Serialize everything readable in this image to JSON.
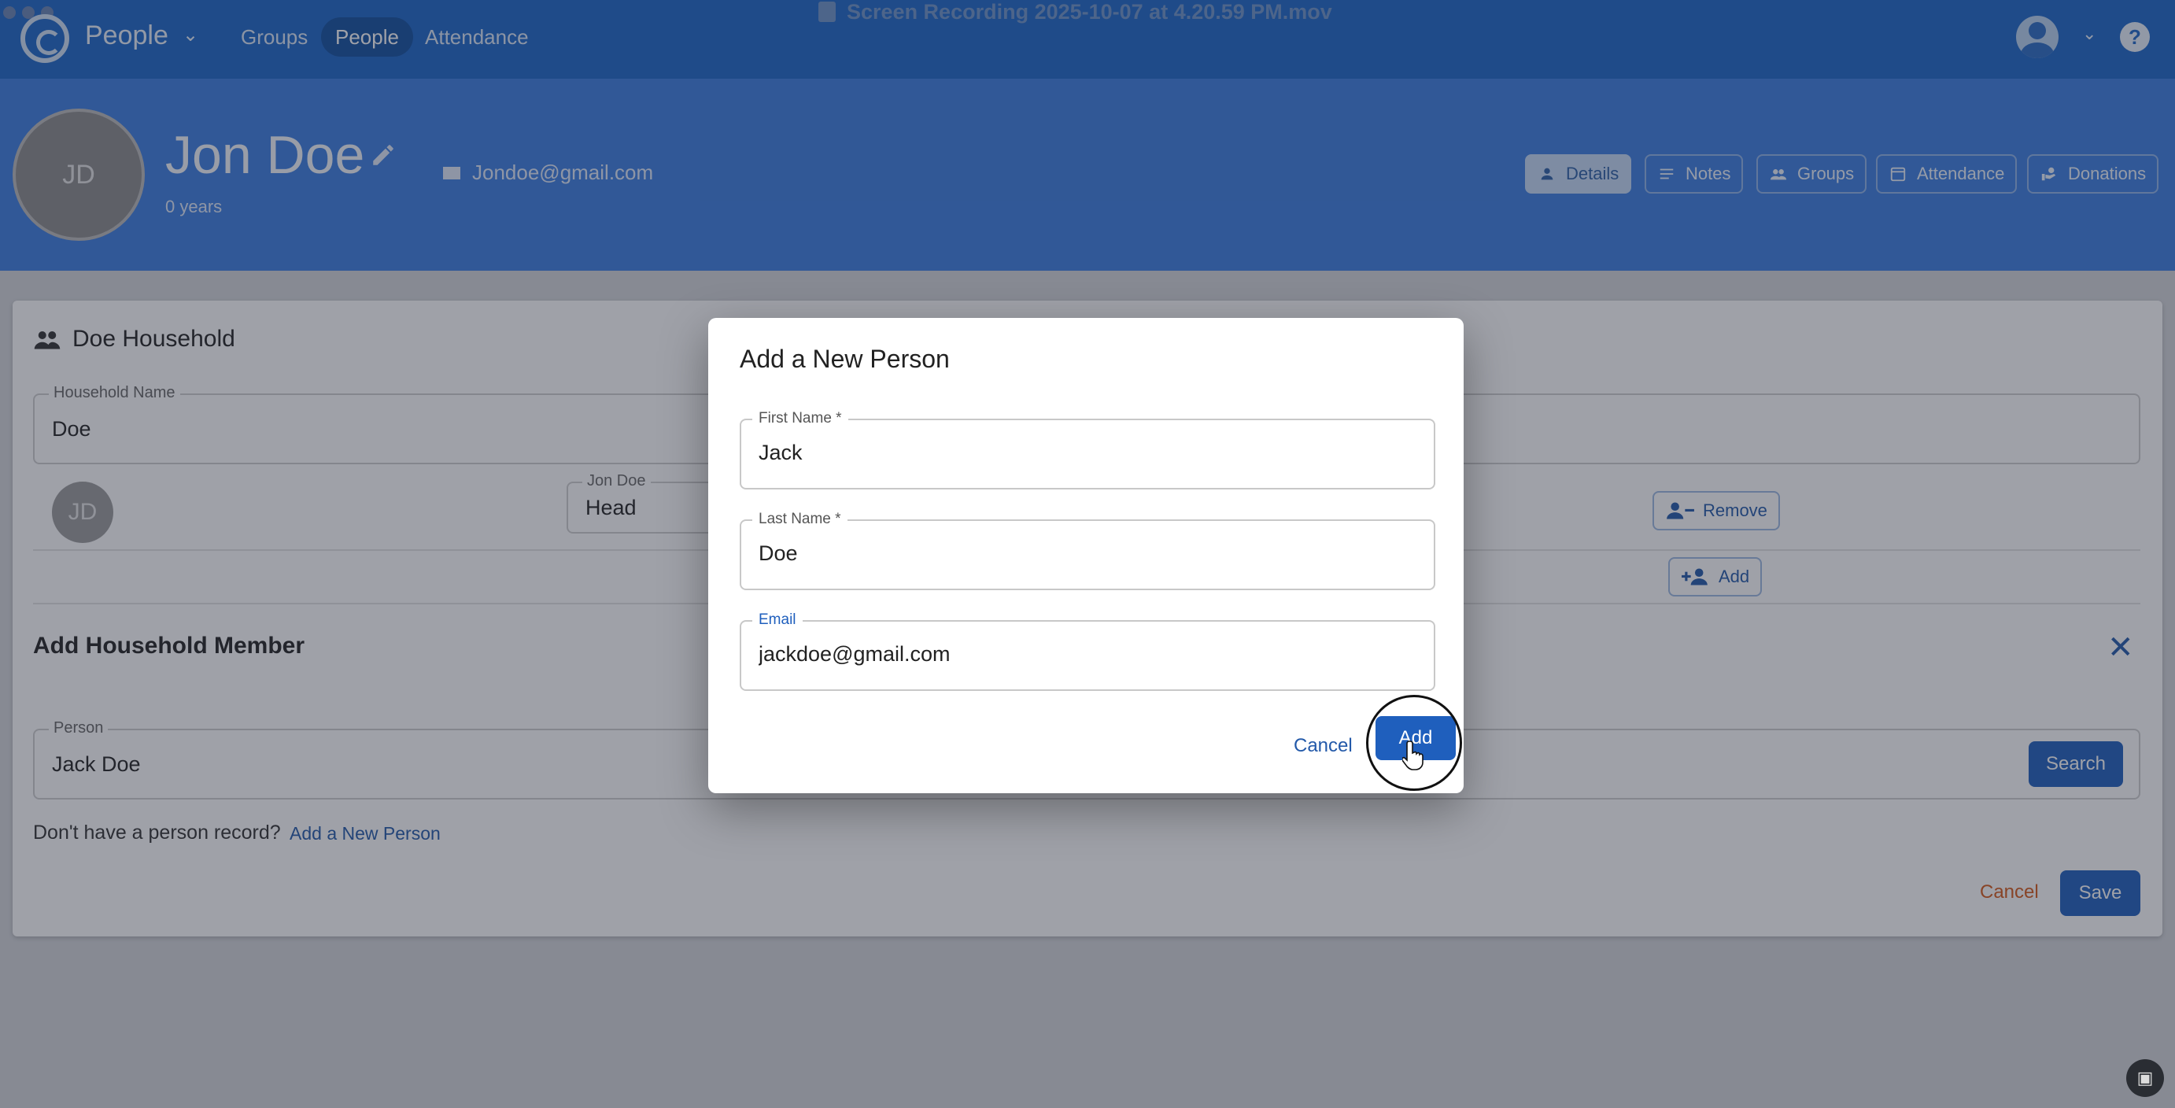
{
  "app": {
    "name": "People",
    "recording_title": "Screen Recording 2025-10-07 at 4.20.59 PM.mov"
  },
  "nav": {
    "items": [
      "Groups",
      "People",
      "Attendance"
    ],
    "active": "People"
  },
  "person": {
    "initials": "JD",
    "name": "Jon Doe",
    "age": "0 years",
    "email": "Jondoe@gmail.com"
  },
  "profile_tabs": [
    "Details",
    "Notes",
    "Groups",
    "Attendance",
    "Donations"
  ],
  "household": {
    "title": "Doe Household",
    "name_label": "Household Name",
    "name_value": "Doe",
    "member": {
      "initials": "JD",
      "role_label": "Jon Doe",
      "role_value": "Head"
    },
    "remove_label": "Remove",
    "add_label": "Add"
  },
  "add_member": {
    "title": "Add Household Member",
    "person_label": "Person",
    "person_value": "Jack Doe",
    "search_label": "Search",
    "no_record_text": "Don't have a person record?",
    "no_record_link": "Add a New Person",
    "cancel_label": "Cancel",
    "save_label": "Save"
  },
  "dialog": {
    "title": "Add a New Person",
    "first_name_label": "First Name *",
    "first_name_value": "Jack",
    "last_name_label": "Last Name *",
    "last_name_value": "Doe",
    "email_label": "Email",
    "email_value": "jackdoe@gmail.com",
    "cancel_label": "Cancel",
    "add_label": "Add"
  },
  "colors": {
    "primary": "#1f5fbd",
    "header": "#3b7ee0",
    "topbar": "#1c66c8",
    "cancel": "#d65a1a"
  }
}
